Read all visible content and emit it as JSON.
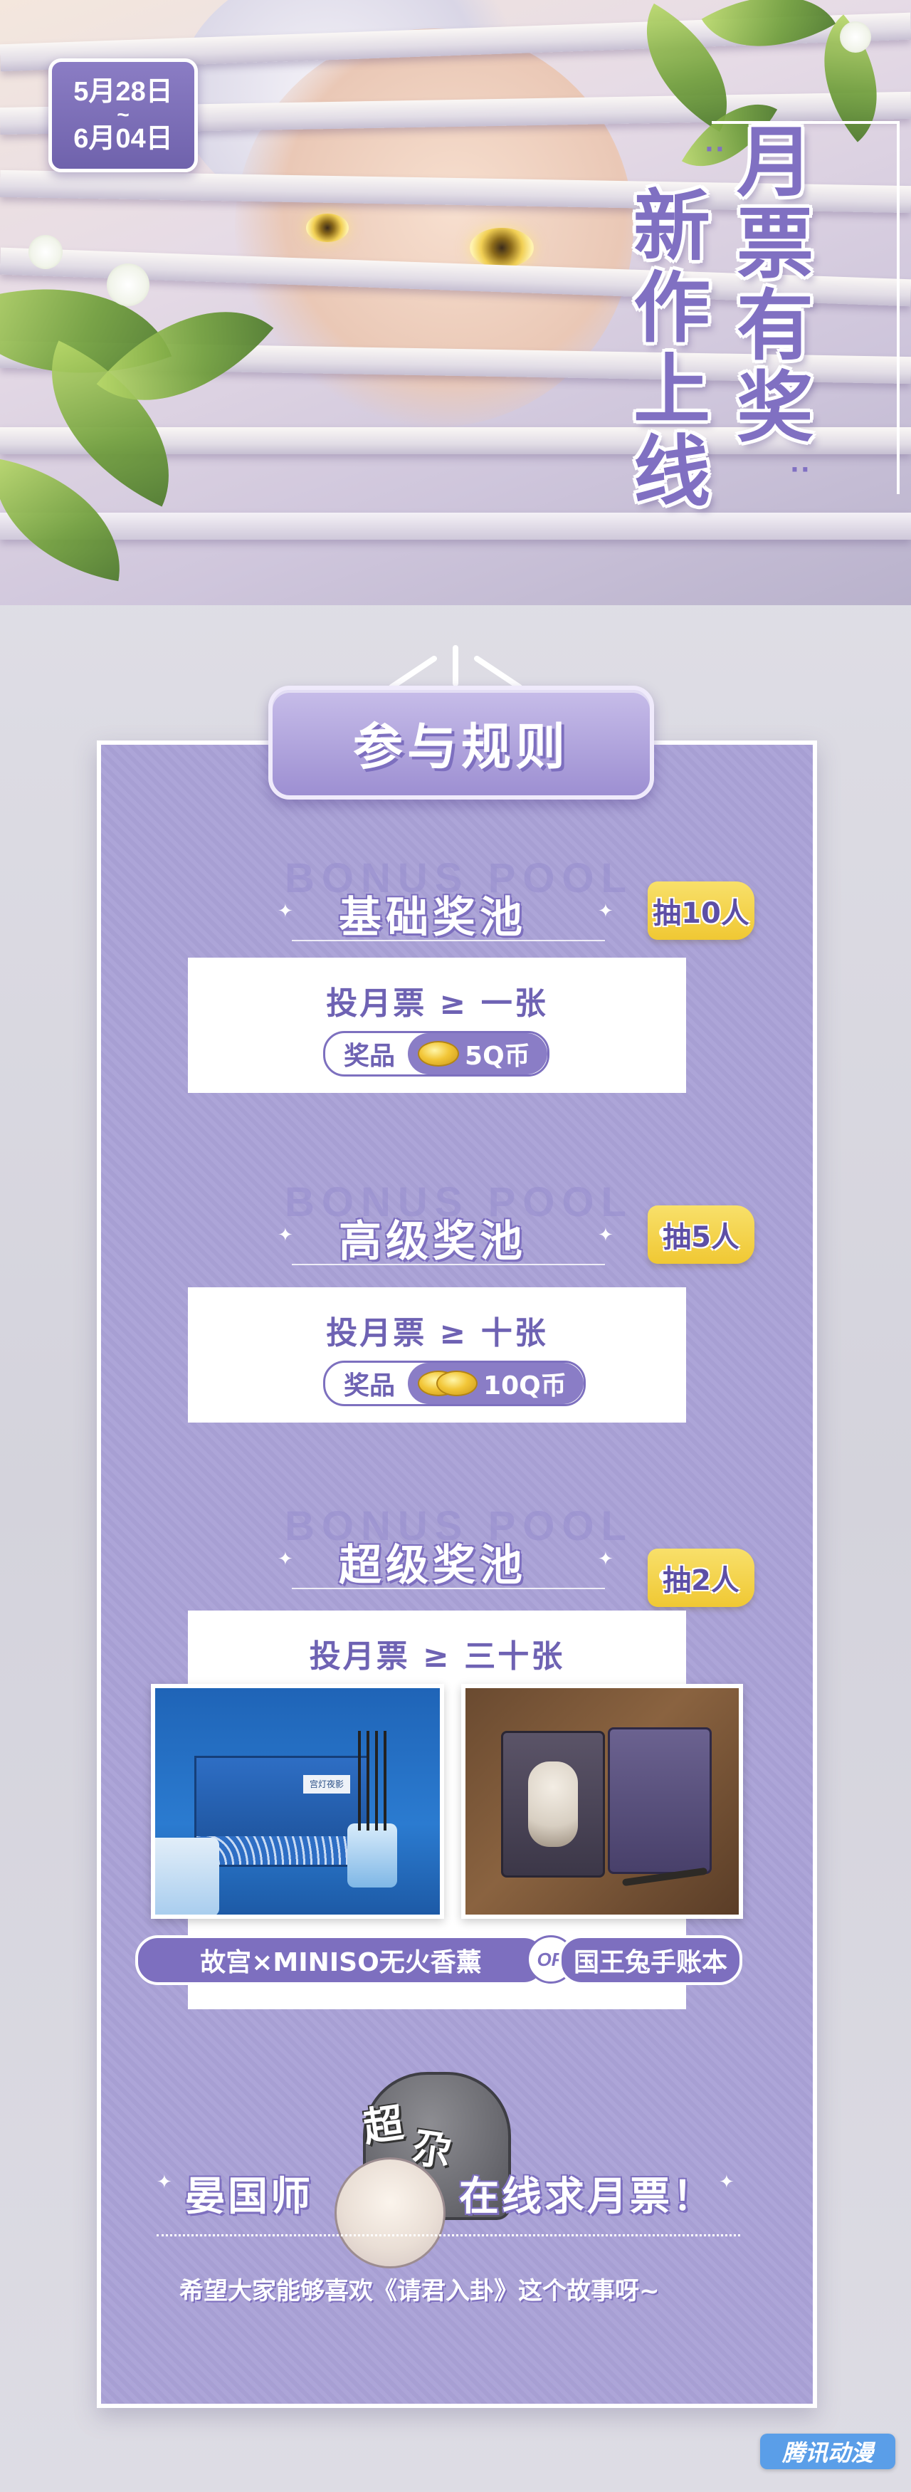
{
  "hero": {
    "date_start": "5月28日",
    "date_sep": "~",
    "date_end": "6月04日",
    "title_chars": [
      "月",
      "票",
      "有",
      "奖",
      "新",
      "作",
      "上",
      "线"
    ],
    "accent_color": "#8070c2"
  },
  "rules": {
    "banner": "参与规则",
    "watermark": "BONUS POOL"
  },
  "pools": [
    {
      "title": "基础奖池",
      "draw": "抽10人",
      "requirement": "投月票 ≥ 一张",
      "prize_label": "奖品",
      "prize_value": "5Q币"
    },
    {
      "title": "高级奖池",
      "draw": "抽5人",
      "requirement": "投月票 ≥ 十张",
      "prize_label": "奖品",
      "prize_value": "10Q币"
    },
    {
      "title": "超级奖池",
      "draw": "抽2人",
      "requirement": "投月票 ≥ 三十张",
      "product_a": "故宫×MINISO无火香薰",
      "or_label": "OR",
      "product_b": "国王兔手账本",
      "box_label": "宫灯夜影"
    }
  ],
  "footer": {
    "tomb_a": "超",
    "tomb_b": "尕",
    "left": "晏国师",
    "right": "在线求月票！",
    "wish": "希望大家能够喜欢《请君入卦》这个故事呀~",
    "logo": "腾讯动漫"
  }
}
